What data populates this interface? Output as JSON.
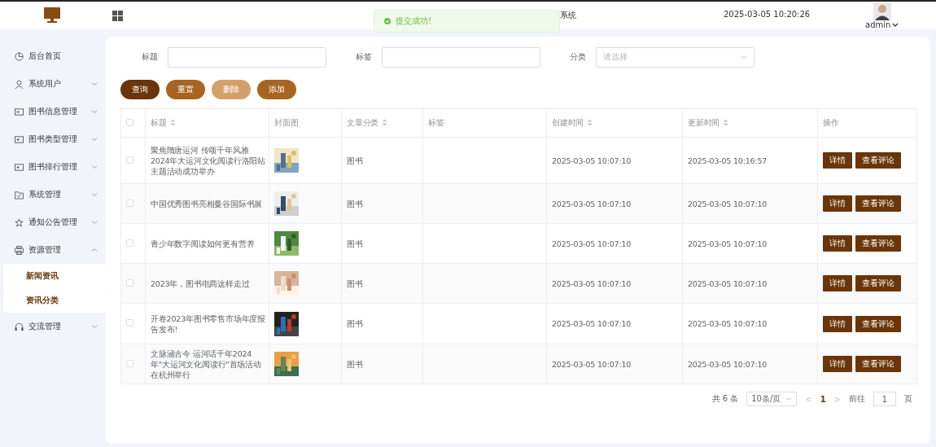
{
  "header": {
    "title_visible": "系统",
    "datetime": "2025-03-05 10:20:26",
    "user": "admin"
  },
  "toast": {
    "message": "提交成功!"
  },
  "sidebar": {
    "items": [
      {
        "label": "后台首页",
        "kind": "link"
      },
      {
        "label": "系统用户",
        "kind": "group",
        "expanded": false
      },
      {
        "label": "图书信息管理",
        "kind": "group",
        "expanded": false
      },
      {
        "label": "图书类型管理",
        "kind": "group",
        "expanded": false
      },
      {
        "label": "图书排行管理",
        "kind": "group",
        "expanded": false
      },
      {
        "label": "系统管理",
        "kind": "group",
        "expanded": false
      },
      {
        "label": "通知公告管理",
        "kind": "group",
        "expanded": false
      },
      {
        "label": "资源管理",
        "kind": "group",
        "expanded": true,
        "children": [
          {
            "label": "新闻资讯"
          },
          {
            "label": "资讯分类"
          }
        ]
      },
      {
        "label": "交流管理",
        "kind": "group",
        "expanded": false
      }
    ]
  },
  "filters": [
    {
      "label": "标题",
      "kind": "text"
    },
    {
      "label": "标签",
      "kind": "text"
    },
    {
      "label": "分类",
      "kind": "select",
      "placeholder": "请选择"
    }
  ],
  "actions": [
    {
      "label": "查询",
      "kind": "primary",
      "disabled": false
    },
    {
      "label": "重置",
      "kind": "secondary",
      "disabled": false
    },
    {
      "label": "删除",
      "kind": "secondary",
      "disabled": true
    },
    {
      "label": "添加",
      "kind": "secondary",
      "disabled": false
    }
  ],
  "table": {
    "all_checked": false,
    "columns": [
      {
        "label": "标题",
        "sortable": true
      },
      {
        "label": "封面图",
        "sortable": false
      },
      {
        "label": "文章分类",
        "sortable": true
      },
      {
        "label": "标签",
        "sortable": false
      },
      {
        "label": "创建时间",
        "sortable": true
      },
      {
        "label": "更新时间",
        "sortable": true
      },
      {
        "label": "操作",
        "sortable": false
      }
    ],
    "rows": [
      {
        "checked": false,
        "title": "聚焦隋唐运河 传颂千年风雅 2024年大运河文化阅读行洛阳站主题活动成功举办",
        "category": "图书",
        "created": "2025-03-05 10:07:10",
        "updated": "2025-03-05 10:16:57",
        "buttons": [
          "详情",
          "查看评论"
        ]
      },
      {
        "checked": false,
        "title": "中国优秀图书亮相曼谷国际书展",
        "category": "图书",
        "created": "2025-03-05 10:07:10",
        "updated": "2025-03-05 10:07:10",
        "buttons": [
          "详情",
          "查看评论"
        ]
      },
      {
        "checked": false,
        "title": "青少年数字阅读如何更有营养",
        "category": "图书",
        "created": "2025-03-05 10:07:10",
        "updated": "2025-03-05 10:07:10",
        "buttons": [
          "详情",
          "查看评论"
        ]
      },
      {
        "checked": false,
        "title": "2023年，图书电商这样走过",
        "category": "图书",
        "created": "2025-03-05 10:07:10",
        "updated": "2025-03-05 10:07:10",
        "buttons": [
          "详情",
          "查看评论"
        ]
      },
      {
        "checked": false,
        "title": "开卷2023年图书零售市场年度报告发布!",
        "category": "图书",
        "created": "2025-03-05 10:07:10",
        "updated": "2025-03-05 10:07:10",
        "buttons": [
          "详情",
          "查看评论"
        ]
      },
      {
        "checked": false,
        "title": "文脉涵古今 运河话千年2024年\"大运河文化阅读行\"首场活动在杭州举行",
        "category": "图书",
        "created": "2025-03-05 10:07:10",
        "updated": "2025-03-05 10:07:10",
        "buttons": [
          "详情",
          "查看评论"
        ]
      }
    ]
  },
  "pagination": {
    "total": "共 6 条",
    "page_size": "10条/页",
    "prev": "<",
    "current": "1",
    "next": ">",
    "goto_label": "前往",
    "goto_value": "1",
    "goto_suffix": "页"
  }
}
